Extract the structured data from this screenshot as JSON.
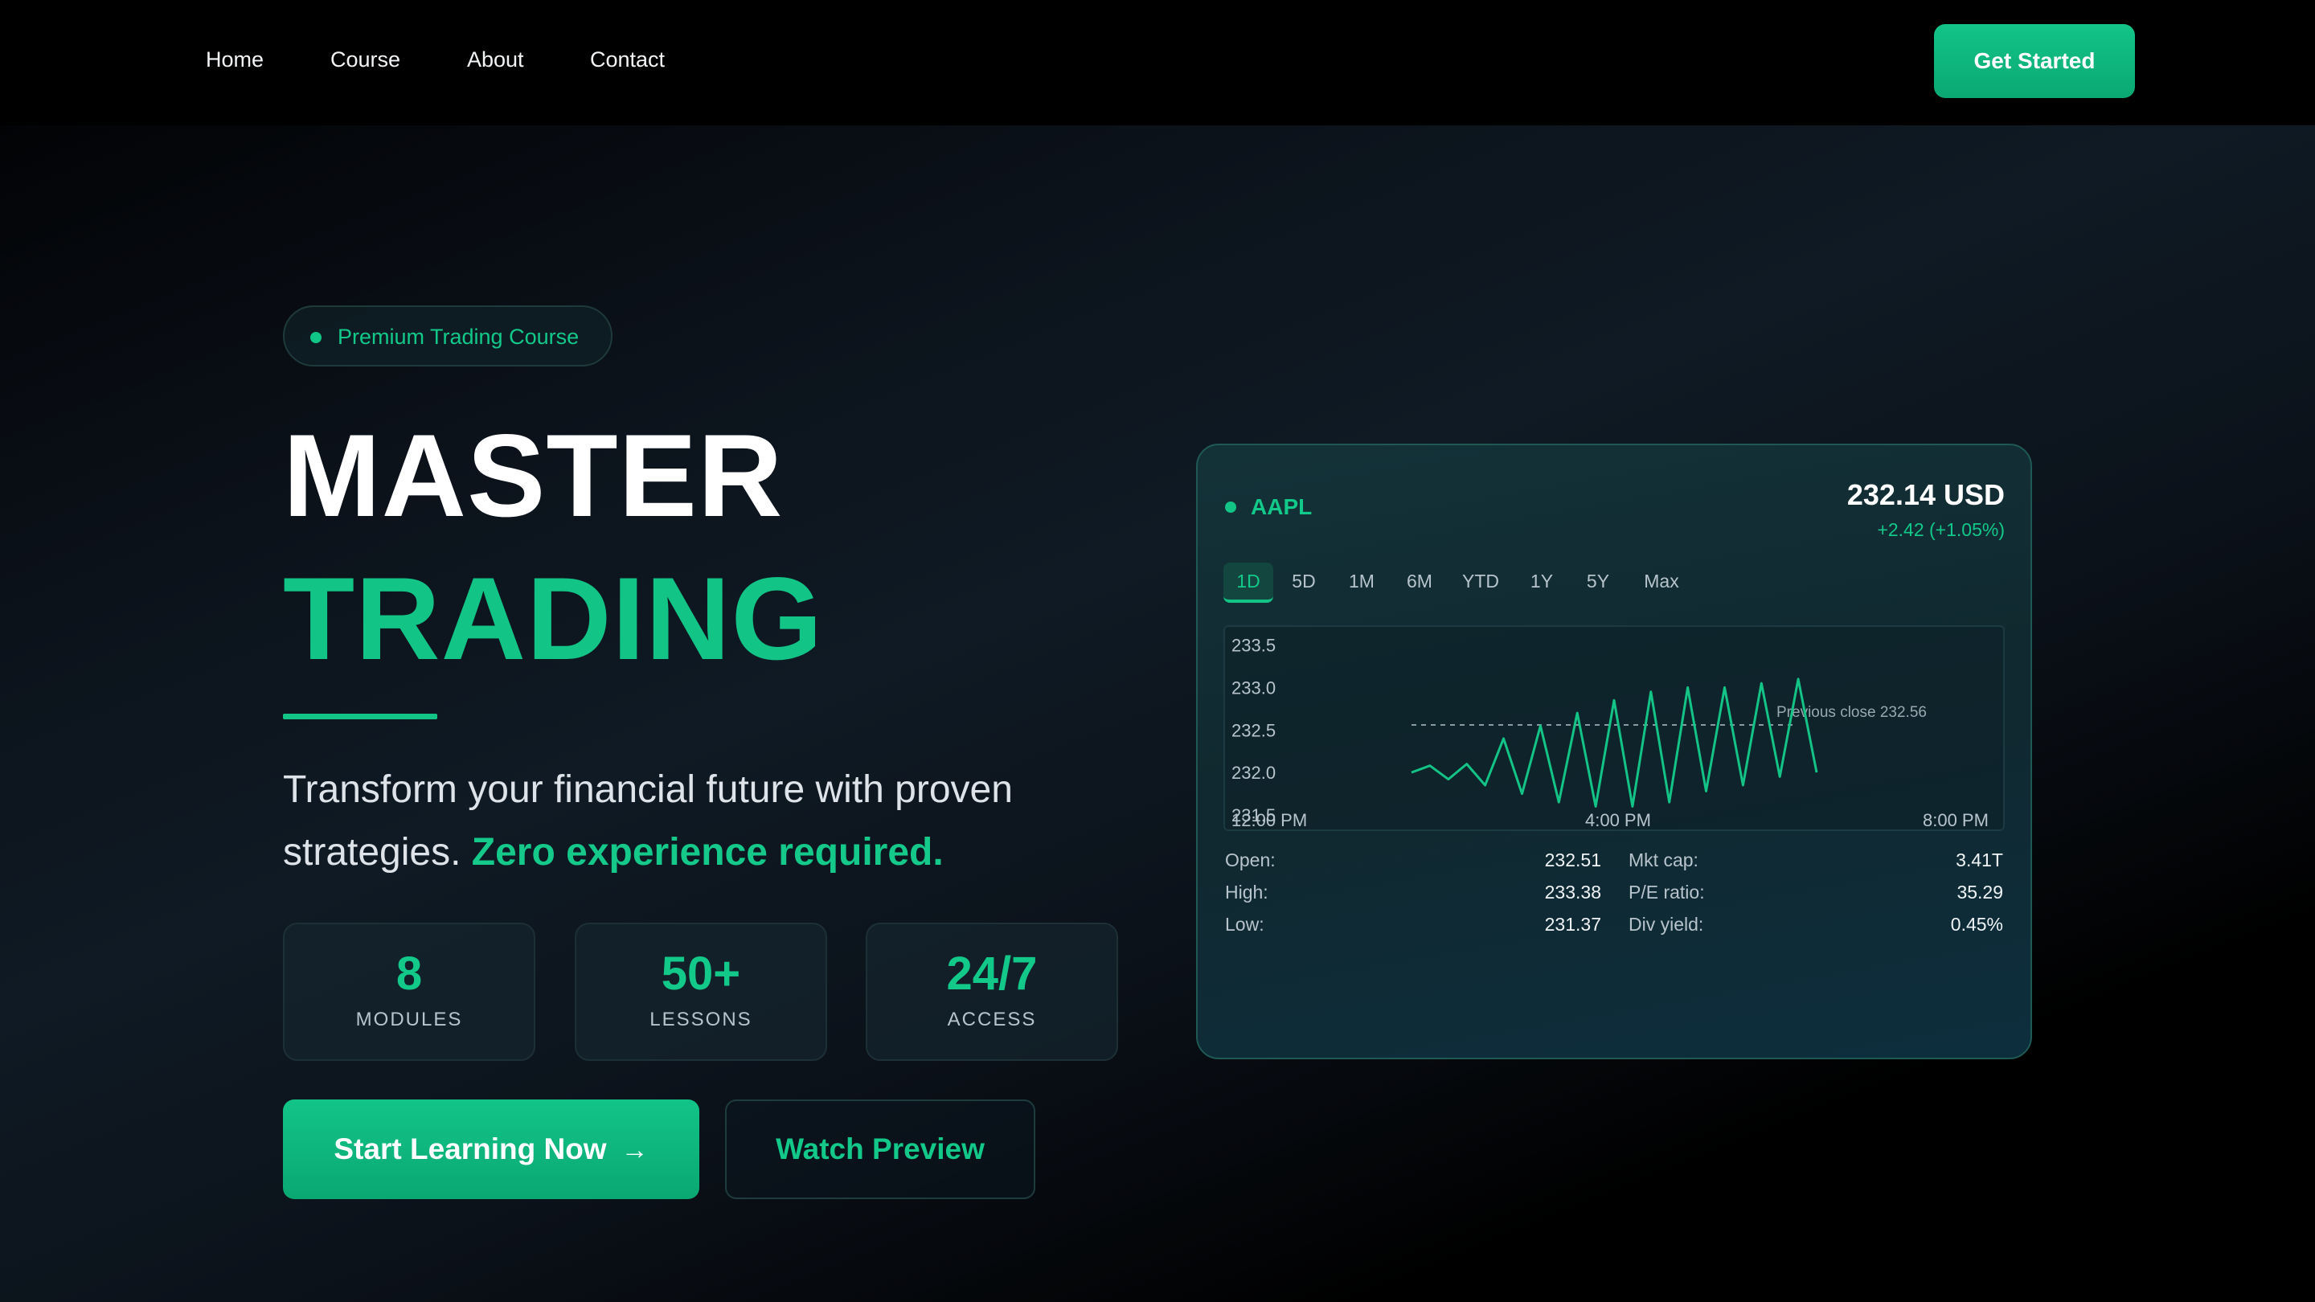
{
  "nav": {
    "links": [
      "Home",
      "Course",
      "About",
      "Contact"
    ],
    "cta": "Get Started"
  },
  "hero": {
    "badge": "Premium Trading Course",
    "title_line1": "MASTER",
    "title_line2": "TRADING",
    "subtitle_plain": "Transform your financial future with proven strategies.",
    "subtitle_accent": "Zero experience required.",
    "stats": [
      {
        "value": "8",
        "label": "MODULES"
      },
      {
        "value": "50+",
        "label": "LESSONS"
      },
      {
        "value": "24/7",
        "label": "ACCESS"
      }
    ],
    "primary_cta": "Start Learning Now",
    "secondary_cta": "Watch Preview"
  },
  "stock": {
    "ticker": "AAPL",
    "price": "232.14 USD",
    "change": "+2.42 (+1.05%)",
    "ranges": [
      "1D",
      "5D",
      "1M",
      "6M",
      "YTD",
      "1Y",
      "5Y",
      "Max"
    ],
    "active_range": "1D",
    "previous_close_label": "Previous close 232.56",
    "details": [
      {
        "label": "Open:",
        "value": "232.51"
      },
      {
        "label": "High:",
        "value": "233.38"
      },
      {
        "label": "Low:",
        "value": "231.37"
      },
      {
        "label": "Mkt cap:",
        "value": "3.41T"
      },
      {
        "label": "P/E ratio:",
        "value": "35.29"
      },
      {
        "label": "Div yield:",
        "value": "0.45%"
      }
    ]
  },
  "colors": {
    "accent": "#12c486",
    "background": "#000000",
    "card": "#12303a"
  },
  "icons": {
    "arrow": "arrow-right-icon",
    "badge_dot": "status-dot-icon",
    "ticker_dot": "status-dot-icon"
  },
  "chart_data": {
    "type": "line",
    "title": "",
    "xlabel": "",
    "ylabel": "",
    "y_ticks": [
      "233.5",
      "233.0",
      "232.5",
      "232.0",
      "231.5"
    ],
    "x_ticks": [
      "12:00 PM",
      "4:00 PM",
      "8:00 PM"
    ],
    "ylim": [
      231.5,
      233.6
    ],
    "previous_close": 232.56,
    "annotation": "Previous close 232.56",
    "series": [
      {
        "values": [
          232.0,
          232.08,
          231.92,
          232.1,
          231.85,
          232.4,
          231.75,
          232.55,
          231.65,
          232.7,
          231.6,
          232.85,
          231.6,
          232.95,
          231.65,
          233.0,
          231.78,
          233.0,
          231.85,
          233.05,
          231.95,
          233.1,
          232.0
        ]
      }
    ]
  }
}
